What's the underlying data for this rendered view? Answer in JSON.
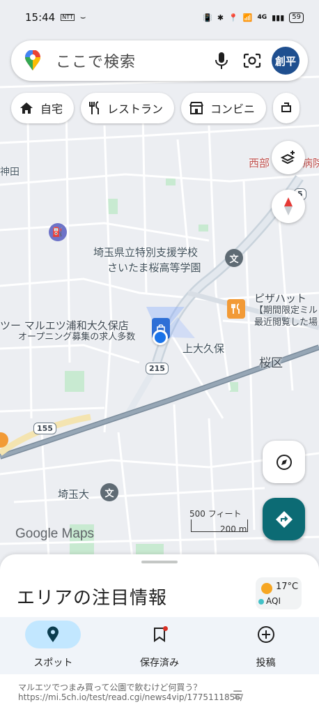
{
  "status_bar": {
    "time": "15:44",
    "carrier_tag": "NTT",
    "net": "4G",
    "battery": "59"
  },
  "search": {
    "placeholder": "ここで検索",
    "avatar_text": "創平"
  },
  "chips": [
    {
      "label": "自宅",
      "icon": "home-icon"
    },
    {
      "label": "レストラン",
      "icon": "fork-knife-icon"
    },
    {
      "label": "コンビニ",
      "icon": "store-icon"
    }
  ],
  "map": {
    "labels": {
      "kanda": "神田",
      "seibu": "西部",
      "hospital_frag": "病院",
      "school_line1": "埼玉県立特別支援学校",
      "school_line2": "さいたま桜高等学園",
      "pizza_name": "ピザハット",
      "pizza_sub1": "【期間限定ミル",
      "pizza_sub2": "最近閲覧した場",
      "maruetsu_name": "ツー マルエツ浦和大久保店",
      "maruetsu_sub": "オープニング募集の求人多数",
      "kamiokubo": "上大久保",
      "sakura_ku": "桜区",
      "saitama_dai": "埼玉大",
      "route_215": "215",
      "route_155": "155",
      "route_5": "5"
    },
    "logo_text": "Google Maps",
    "scale_ft": "500 フィート",
    "scale_m": "200 m"
  },
  "sheet": {
    "title": "エリアの注目情報",
    "weather_temp": "17°C",
    "weather_aqi": "AQI"
  },
  "nav": [
    {
      "label": "スポット",
      "icon": "location-pin-icon",
      "active": true
    },
    {
      "label": "保存済み",
      "icon": "bookmark-icon",
      "active": false
    },
    {
      "label": "投稿",
      "icon": "add-circle-icon",
      "active": false
    }
  ],
  "notification": {
    "text": "マルエツでつまみ買って公園で飲むけど何買う？",
    "url": "https://mi.5ch.io/test/read.cgi/news4vip/1775111856/"
  },
  "colors": {
    "accent": "#0c6b74",
    "nav_active": "#c2e7ff",
    "avatar_bg": "#1f4f8f"
  }
}
